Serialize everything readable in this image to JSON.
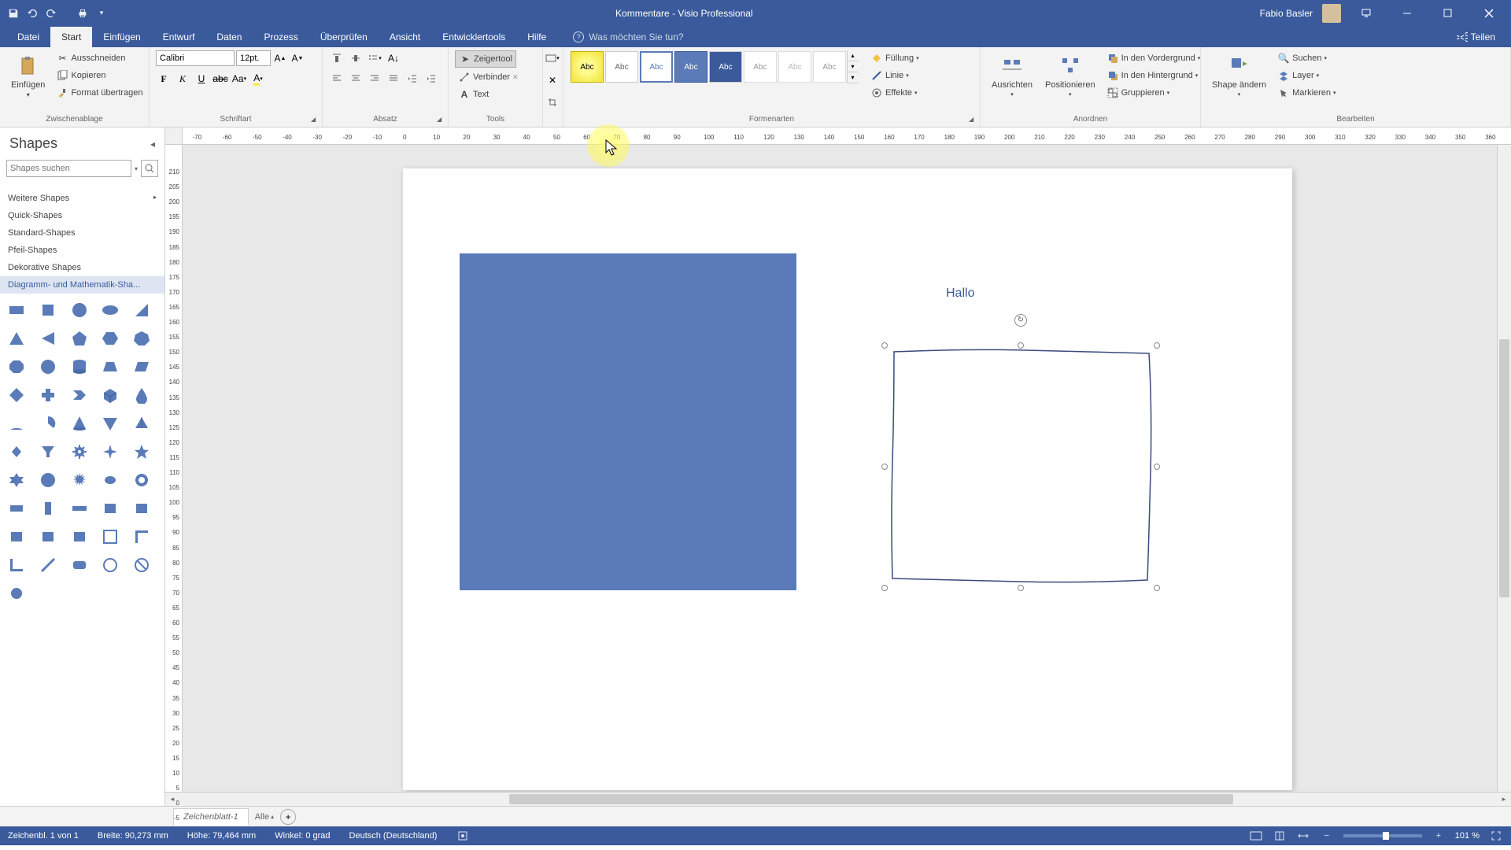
{
  "titlebar": {
    "doc_title": "Kommentare",
    "app_name": "Visio Professional",
    "user_name": "Fabio Basler"
  },
  "menu": {
    "datei": "Datei",
    "start": "Start",
    "einfuegen": "Einfügen",
    "entwurf": "Entwurf",
    "daten": "Daten",
    "prozess": "Prozess",
    "ueberpruefen": "Überprüfen",
    "ansicht": "Ansicht",
    "entwicklertools": "Entwicklertools",
    "hilfe": "Hilfe",
    "tellme": "Was möchten Sie tun?",
    "teilen": "Teilen"
  },
  "ribbon": {
    "zwischenablage": {
      "label": "Zwischenablage",
      "einfuegen": "Einfügen",
      "ausschneiden": "Ausschneiden",
      "kopieren": "Kopieren",
      "format": "Format übertragen"
    },
    "schriftart": {
      "label": "Schriftart",
      "font": "Calibri",
      "size": "12pt."
    },
    "absatz": {
      "label": "Absatz"
    },
    "tools": {
      "label": "Tools",
      "zeigertool": "Zeigertool",
      "verbinder": "Verbinder",
      "text": "Text"
    },
    "formenarten": {
      "label": "Formenarten",
      "abc": "Abc",
      "fuellung": "Füllung",
      "linie": "Linie",
      "effekte": "Effekte"
    },
    "anordnen": {
      "label": "Anordnen",
      "ausrichten": "Ausrichten",
      "positionieren": "Positionieren",
      "vordergrund": "In den Vordergrund",
      "hintergrund": "In den Hintergrund",
      "gruppieren": "Gruppieren"
    },
    "bearbeiten": {
      "label": "Bearbeiten",
      "shape_aendern": "Shape ändern",
      "suchen": "Suchen",
      "layer": "Layer",
      "markieren": "Markieren"
    }
  },
  "shapes": {
    "title": "Shapes",
    "search_placeholder": "Shapes suchen",
    "weitere": "Weitere Shapes",
    "quick": "Quick-Shapes",
    "standard": "Standard-Shapes",
    "pfeil": "Pfeil-Shapes",
    "dekorative": "Dekorative Shapes",
    "diagramm": "Diagramm- und Mathematik-Sha..."
  },
  "canvas": {
    "hallo": "Hallo"
  },
  "tabs": {
    "sheet1": "Zeichenblatt-1",
    "alle": "Alle"
  },
  "statusbar": {
    "page_info": "Zeichenbl. 1 von 1",
    "breite": "Breite: 90,273 mm",
    "hoehe": "Höhe: 79,464 mm",
    "winkel": "Winkel: 0 grad",
    "lang": "Deutsch (Deutschland)",
    "zoom": "101 %"
  }
}
